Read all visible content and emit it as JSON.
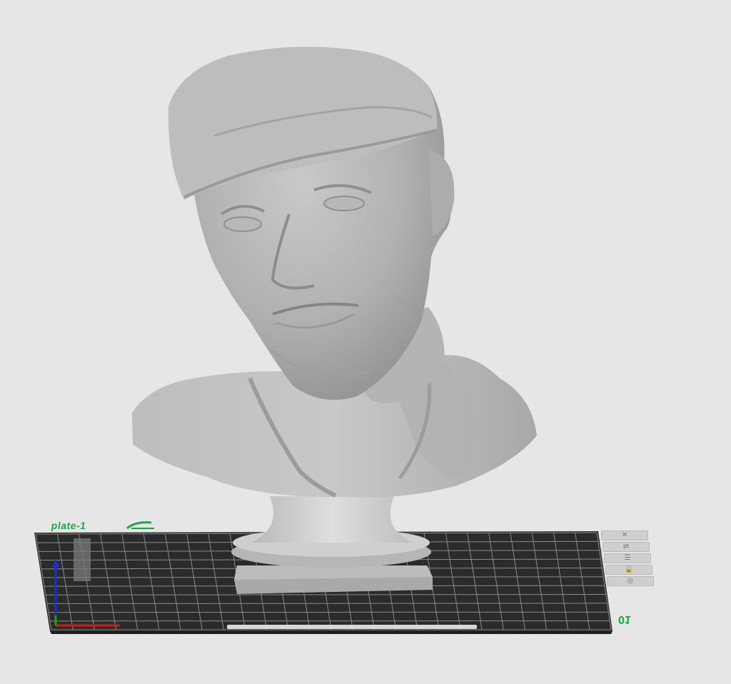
{
  "viewport": {
    "plate_name": "plate-1",
    "plate_number": "01",
    "model_name": "bust",
    "background_color": "#e6e6e6",
    "plate_color": "#2b2b2b",
    "grid_color": "#8a8a8a",
    "accent_color": "#19a84a",
    "axis_colors": {
      "x": "#d11a1a",
      "y": "#1aa31a",
      "z": "#1a2fd6"
    }
  },
  "plate_tools": [
    {
      "name": "remove-plate-icon",
      "glyph": "✕"
    },
    {
      "name": "arrange-icon",
      "glyph": "⇄"
    },
    {
      "name": "orient-icon",
      "glyph": "☰"
    },
    {
      "name": "lock-icon",
      "glyph": "🔒"
    },
    {
      "name": "settings-icon",
      "glyph": "◎"
    }
  ]
}
